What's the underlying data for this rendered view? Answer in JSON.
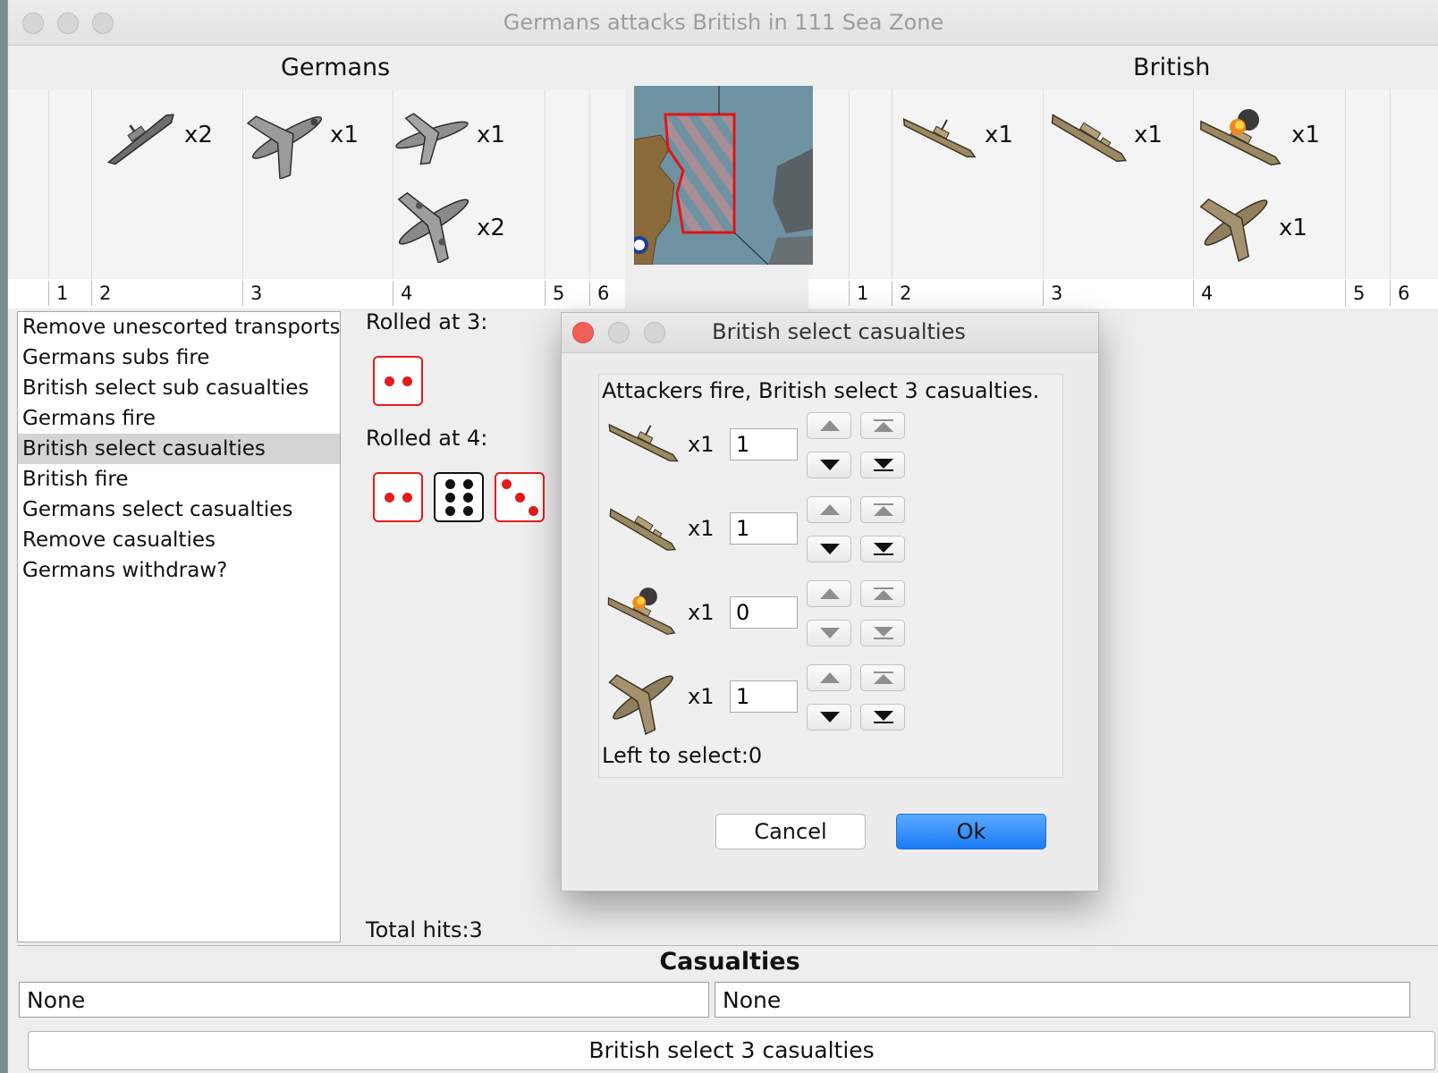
{
  "window": {
    "title": "Germans attacks British in 111 Sea Zone"
  },
  "attacker": {
    "name": "Germans",
    "units": [
      {
        "icon": "battleship-icon",
        "count": "x2"
      },
      {
        "icon": "fighter-icon",
        "count": "x1"
      },
      {
        "icon": "tactical-bomber-icon",
        "count": "x1"
      },
      {
        "icon": "bomber-icon",
        "count": "x2"
      }
    ],
    "column_numbers": [
      "1",
      "2",
      "3",
      "4",
      "5",
      "6"
    ]
  },
  "defender": {
    "name": "British",
    "units": [
      {
        "icon": "cruiser-icon",
        "count": "x1"
      },
      {
        "icon": "battleship-icon",
        "count": "x1"
      },
      {
        "icon": "damaged-battleship-icon",
        "count": "x1"
      },
      {
        "icon": "fighter-icon",
        "count": "x1"
      }
    ],
    "column_numbers": [
      "1",
      "2",
      "3",
      "4",
      "5",
      "6"
    ]
  },
  "steps": [
    "Remove unescorted transports",
    "Germans subs fire",
    "British select sub casualties",
    "Germans fire",
    "British select casualties",
    "British fire",
    "Germans select casualties",
    "Remove casualties",
    "Germans withdraw?"
  ],
  "selected_step_index": 4,
  "rolls": {
    "group1_label": "Rolled at 3:",
    "group1_dice": [
      2
    ],
    "group2_label": "Rolled at 4:",
    "group2_dice": [
      2,
      6,
      3
    ],
    "total_hits": "Total hits:3"
  },
  "casualties": {
    "title": "Casualties",
    "left": "None",
    "right": "None"
  },
  "status": "British select 3 casualties",
  "dialog": {
    "title": "British select casualties",
    "message": "Attackers fire, British select 3 casualties.",
    "rows": [
      {
        "icon": "cruiser-icon",
        "count": "x1",
        "value": "1"
      },
      {
        "icon": "battleship-icon",
        "count": "x1",
        "value": "1"
      },
      {
        "icon": "damaged-battleship-icon",
        "count": "x1",
        "value": "0"
      },
      {
        "icon": "fighter-icon",
        "count": "x1",
        "value": "1"
      }
    ],
    "left_to_select": "Left to select:0",
    "cancel_label": "Cancel",
    "ok_label": "Ok"
  }
}
